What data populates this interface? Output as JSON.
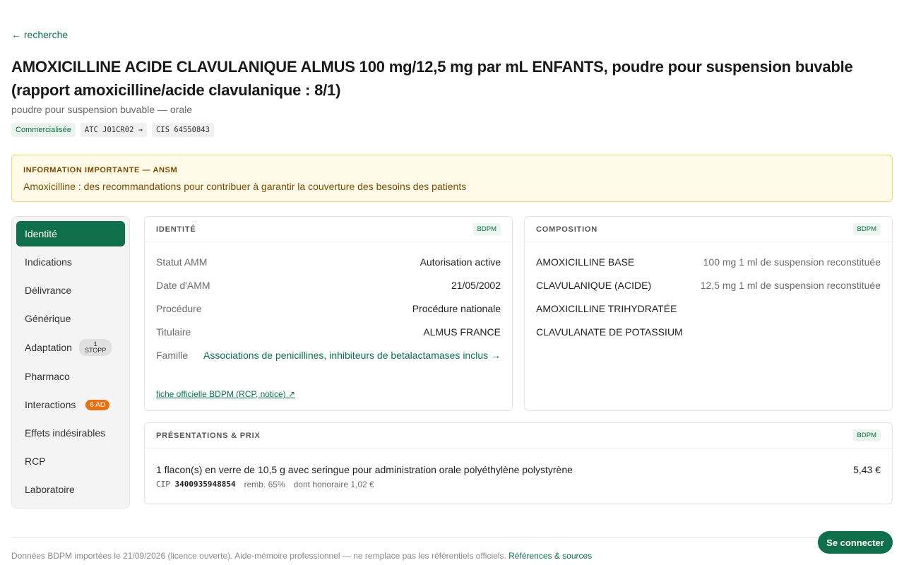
{
  "nav": {
    "back_label": "← recherche"
  },
  "product": {
    "title": "AMOXICILLINE ACIDE CLAVULANIQUE ALMUS 100 mg/12,5 mg par mL ENFANTS, poudre pour suspension buvable (rapport amoxicilline/acide clavulanique : 8/1)",
    "subtitle": "poudre pour suspension buvable — orale",
    "status_chip": "Commercialisée",
    "atc_chip": "ATC J01CR02 →",
    "cis_chip": "CIS 64550843"
  },
  "alert": {
    "title": "INFORMATION IMPORTANTE — ANSM",
    "text": "Amoxicilline : des recommandations pour contribuer à garantir la couverture des besoins des patients"
  },
  "sidebar": {
    "items": [
      {
        "label": "Identité",
        "active": true
      },
      {
        "label": "Indications"
      },
      {
        "label": "Délivrance"
      },
      {
        "label": "Générique"
      },
      {
        "label": "Adaptation",
        "badge_top": "1",
        "badge_bottom": "STOPP"
      },
      {
        "label": "Pharmaco"
      },
      {
        "label": "Interactions",
        "badge": "6 AD"
      },
      {
        "label": "Effets indésirables"
      },
      {
        "label": "RCP"
      },
      {
        "label": "Laboratoire"
      }
    ]
  },
  "identity": {
    "title": "IDENTITÉ",
    "source": "BDPM",
    "rows": [
      {
        "key": "Statut AMM",
        "value": "Autorisation active"
      },
      {
        "key": "Date d'AMM",
        "value": "21/05/2002"
      },
      {
        "key": "Procédure",
        "value": "Procédure nationale"
      },
      {
        "key": "Titulaire",
        "value": "ALMUS FRANCE"
      }
    ],
    "family_key": "Famille",
    "family_value": "Associations de penicillines, inhibiteurs de betalactamases inclus →",
    "link": "fiche officielle BDPM (RCP, notice) ↗"
  },
  "composition": {
    "title": "COMPOSITION",
    "source": "BDPM",
    "rows": [
      {
        "name": "AMOXICILLINE BASE",
        "dose": "100 mg 1 ml de suspension reconstituée"
      },
      {
        "name": "CLAVULANIQUE (ACIDE)",
        "dose": "12,5 mg 1 ml de suspension reconstituée"
      },
      {
        "name": "AMOXICILLINE TRIHYDRATÉE",
        "dose": ""
      },
      {
        "name": "CLAVULANATE DE POTASSIUM",
        "dose": ""
      }
    ]
  },
  "presentations": {
    "title": "PRÉSENTATIONS & PRIX",
    "source": "BDPM",
    "label": "1 flacon(s) en verre de 10,5 g avec seringue pour administration orale polyéthylène polystyrène",
    "price": "5,43 €",
    "cip_label": "CIP",
    "cip_value": "3400935948854",
    "remb": "remb. 65%",
    "honoraire": "dont honoraire 1,02 €"
  },
  "footer": {
    "text": "Données BDPM importées le 21/09/2026 (licence ouverte). Aide-mémoire professionnel — ne remplace pas les référentiels officiels.",
    "link": "Références & sources"
  },
  "auth": {
    "login_label": "Se connecter"
  }
}
